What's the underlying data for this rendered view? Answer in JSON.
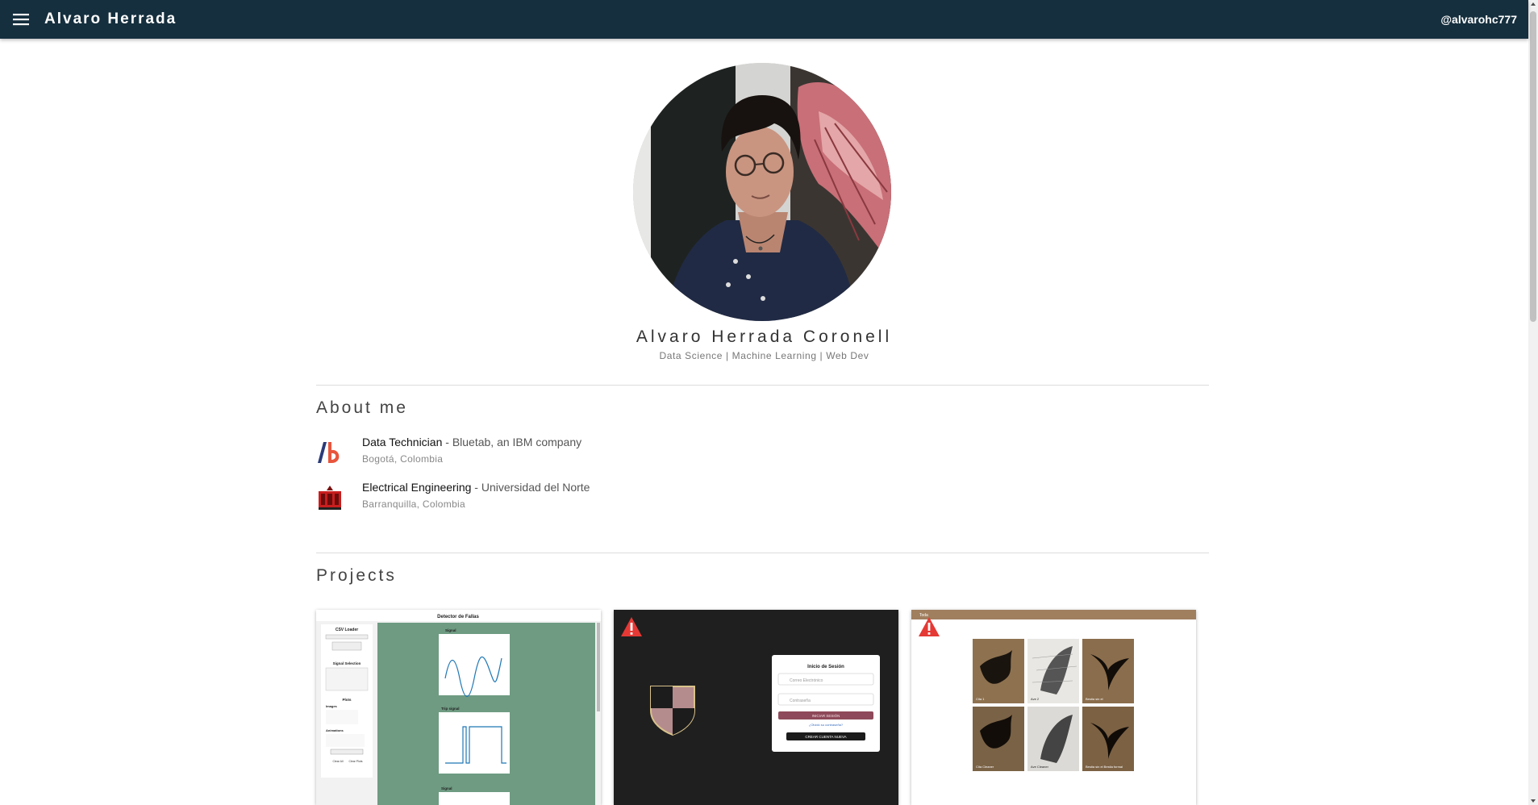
{
  "appbar": {
    "brand": "Alvaro Herrada",
    "handle": "@alvarohc777",
    "background": "#152f3e"
  },
  "profile": {
    "name": "Alvaro Herrada Coronell",
    "tagline": "Data Science | Machine Learning | Web Dev"
  },
  "about": {
    "title": "About me",
    "items": [
      {
        "logo": "bluetab-logo",
        "role": "Data Technician",
        "org": " - Bluetab, an IBM company",
        "location": "Bogotá, Colombia"
      },
      {
        "logo": "uninorte-logo",
        "role": "Electrical Engineering",
        "org": " - Universidad del Norte",
        "location": "Barranquilla, Colombia"
      }
    ]
  },
  "projects": {
    "title": "Projects",
    "cards": [
      {
        "title": "Detector de Fallas",
        "panel_title": "CSV Loader",
        "subtitles": [
          "Signal",
          "Trip signal",
          "Signal"
        ],
        "sidebar_sections": [
          "Signal Selection",
          "Plots",
          "Images",
          "Animations"
        ],
        "buttons": [
          "Clear All",
          "Clear Plots"
        ]
      },
      {
        "title": "Inicio de Sesión",
        "email_placeholder": "Correo Electrónico",
        "password_placeholder": "Contraseña",
        "login_button": "INICIAR SESIÓN",
        "forgot_link": "¿Olvidó su contraseña?",
        "create_account": "CREAR CUENTA NUEVA",
        "warning_icon": "warning-icon"
      },
      {
        "app_name": "Toda",
        "warning_icon": "warning-icon",
        "tiles": [
          "Cita 1",
          "Ave 2",
          "Bestia sin el",
          "Cita Cleaner",
          "Ave Cleaner",
          "Bestia sin el Bestia formal"
        ]
      }
    ]
  }
}
